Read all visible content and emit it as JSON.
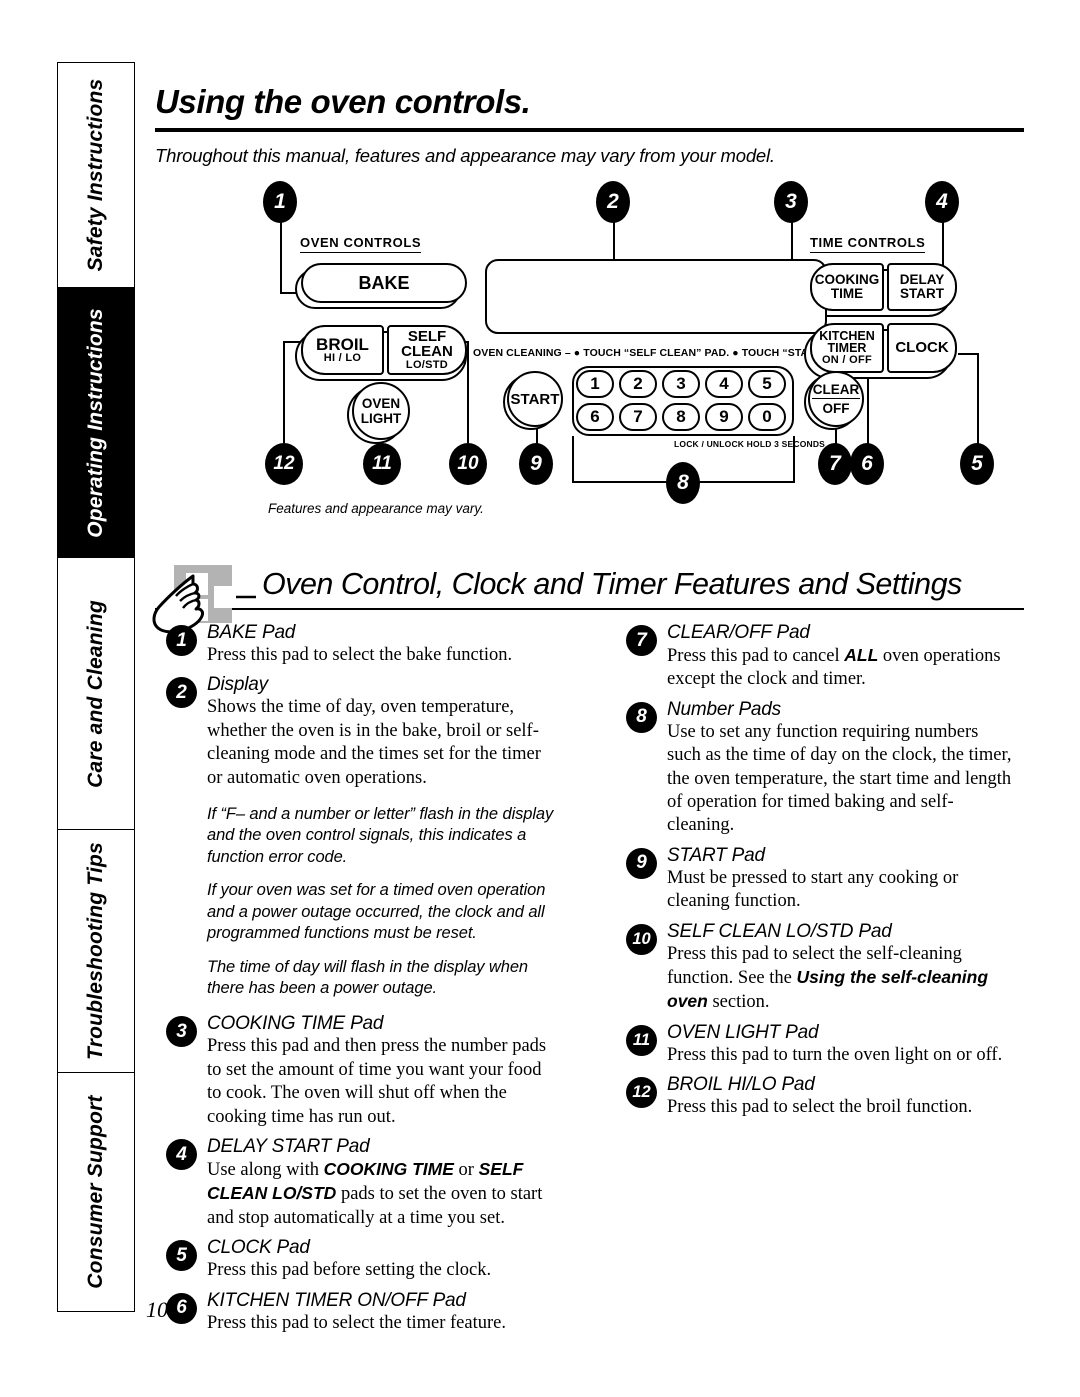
{
  "sidebar": {
    "tabs": [
      {
        "label": "Safety Instructions",
        "active": false
      },
      {
        "label": "Operating Instructions",
        "active": true
      },
      {
        "label": "Care and Cleaning",
        "active": false
      },
      {
        "label": "Troubleshooting Tips",
        "active": false
      },
      {
        "label": "Consumer Support",
        "active": false
      }
    ]
  },
  "page": {
    "number": "10",
    "title": "Using the oven controls.",
    "intro": "Throughout this manual, features and appearance may vary from your model."
  },
  "diagram": {
    "caption": "Features and appearance may vary.",
    "group_labels": {
      "oven_controls": "OVEN  CONTROLS",
      "time_controls": "TIME CONTROLS"
    },
    "pads": {
      "bake": "BAKE",
      "broil_main": "BROIL",
      "broil_sub": "HI / LO",
      "self_clean_main": "SELF",
      "self_clean_main2": "CLEAN",
      "self_clean_sub": "LO/STD",
      "oven_light_1": "OVEN",
      "oven_light_2": "LIGHT",
      "start": "START",
      "clear": "CLEAR",
      "off": "OFF",
      "cooking_time_1": "COOKING",
      "cooking_time_2": "TIME",
      "delay_start_1": "DELAY",
      "delay_start_2": "START",
      "kitchen_timer_1": "KITCHEN",
      "kitchen_timer_2": "TIMER",
      "kitchen_timer_3": "ON / OFF",
      "clock": "CLOCK"
    },
    "number_keys": [
      "1",
      "2",
      "3",
      "4",
      "5",
      "6",
      "7",
      "8",
      "9",
      "0"
    ],
    "oven_cleaning_strip": "OVEN CLEANING –   ● TOUCH “SELF CLEAN” PAD.  ● TOUCH “START” PAD.",
    "lock_strip": "LOCK / UNLOCK  HOLD  3  SECONDS",
    "callouts": [
      "1",
      "2",
      "3",
      "4",
      "5",
      "6",
      "7",
      "8",
      "9",
      "10",
      "11",
      "12"
    ]
  },
  "section": {
    "heading": "Oven Control, Clock and Timer Features and Settings"
  },
  "left_column": {
    "item1": {
      "num": "1",
      "title": "BAKE Pad",
      "body": "Press this pad to select the bake function."
    },
    "item2": {
      "num": "2",
      "title": "Display",
      "body": "Shows the time of day, oven temperature, whether the oven is in the bake, broil or self-cleaning mode and the times set for the timer or automatic oven operations."
    },
    "notes": [
      "If “F– and a number or letter” flash in the display and the oven control signals, this indicates a function error code.",
      "If your oven was set for a timed oven operation and a power outage occurred, the clock and all programmed functions must be reset.",
      "The time of day will flash in the display when there has been a power outage."
    ],
    "item3": {
      "num": "3",
      "title": "COOKING TIME Pad",
      "body": "Press this pad and then press the number pads to set the amount of time you want your food to cook. The oven will shut off when the cooking time has run out."
    },
    "item4": {
      "num": "4",
      "title": "DELAY START Pad",
      "body_pre": "Use along with ",
      "body_b1": "COOKING TIME",
      "body_mid": " or ",
      "body_b2": "SELF CLEAN LO/STD",
      "body_post": " pads to set the oven to start and stop automatically at a time you set."
    },
    "item5": {
      "num": "5",
      "title": "CLOCK Pad",
      "body": "Press this pad before setting the clock."
    },
    "item6": {
      "num": "6",
      "title": "KITCHEN TIMER ON/OFF Pad",
      "body": "Press this pad to select the timer feature."
    }
  },
  "right_column": {
    "item7": {
      "num": "7",
      "title": "CLEAR/OFF Pad",
      "body_pre": "Press this pad to cancel ",
      "body_b1": "ALL",
      "body_post": "  oven operations except the clock and timer."
    },
    "item8": {
      "num": "8",
      "title": "Number Pads",
      "body": "Use to set any function requiring numbers such as the time of day on the clock, the timer, the oven temperature, the start time and length of operation for timed baking and self-cleaning."
    },
    "item9": {
      "num": "9",
      "title": "START Pad",
      "body": "Must be pressed to start any cooking or cleaning function."
    },
    "item10": {
      "num": "10",
      "title": "SELF CLEAN LO/STD Pad",
      "body_pre": "Press this pad to select the self-cleaning function. See the ",
      "body_i1": "Using the self-cleaning oven",
      "body_post": " section."
    },
    "item11": {
      "num": "11",
      "title": "OVEN LIGHT Pad",
      "body": "Press this pad to turn the oven light on or off."
    },
    "item12": {
      "num": "12",
      "title": "BROIL HI/LO Pad",
      "body": "Press this pad to select the broil function."
    }
  },
  "colors": {
    "ink": "#000000",
    "paper": "#ffffff",
    "hand_gray": "#b3b3b3"
  }
}
